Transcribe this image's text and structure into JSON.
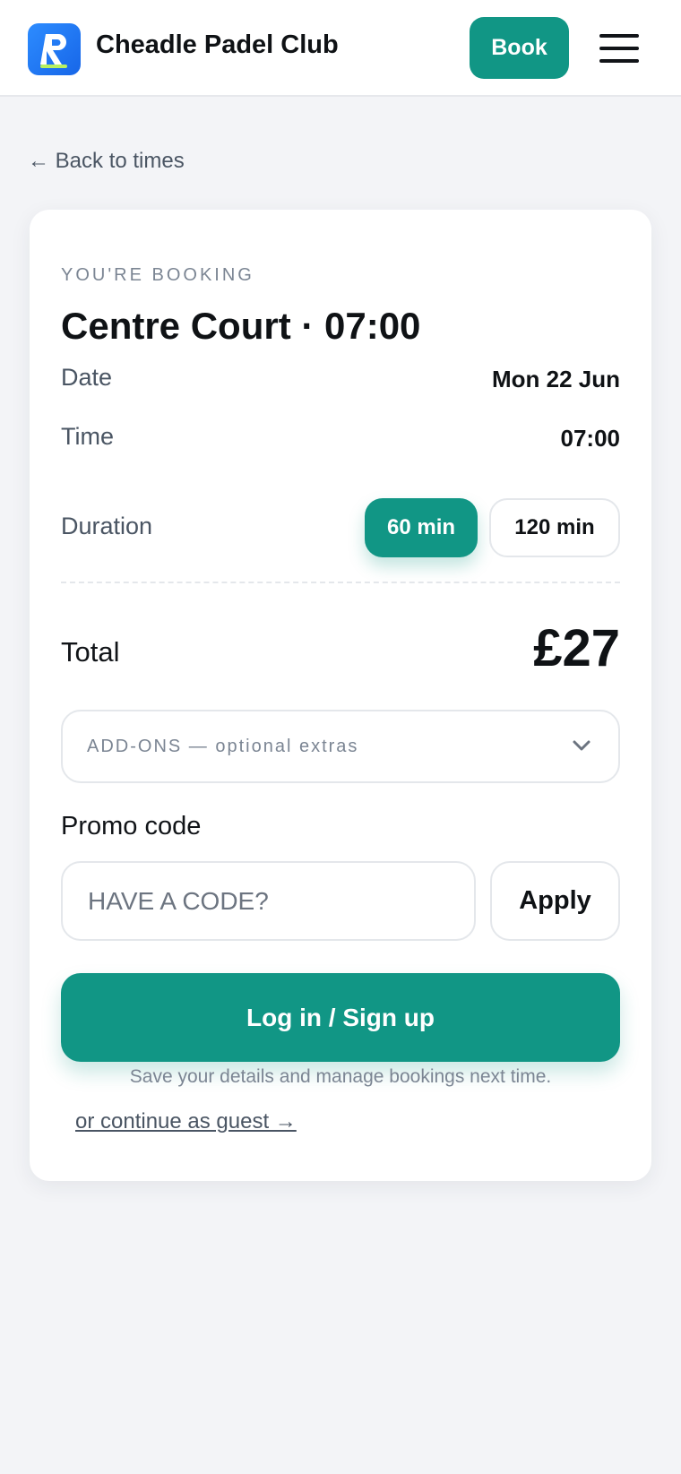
{
  "header": {
    "club_name": "Cheadle Padel Club",
    "book_label": "Book",
    "brand_color": "#119685",
    "logo_color": "#1f7cf2",
    "logo_letter": "R"
  },
  "back_link": "← Back to times",
  "booking": {
    "eyebrow": "YOU'RE BOOKING",
    "title": "Centre Court · 07:00",
    "rows": {
      "date": {
        "label": "Date",
        "value": "Mon 22 Jun"
      },
      "time": {
        "label": "Time",
        "value": "07:00"
      },
      "duration": {
        "label": "Duration",
        "options": [
          "60 min",
          "120 min"
        ],
        "selected": "60 min"
      }
    },
    "total": {
      "label": "Total",
      "value": "£27"
    },
    "addons_label": "ADD-ONS — optional extras",
    "promo": {
      "label": "Promo code",
      "placeholder": "HAVE A CODE?",
      "value": "",
      "apply_label": "Apply"
    },
    "login_label": "Log in / Sign up",
    "helper_text": "Save your details and manage bookings next time.",
    "guest_link": "or continue as guest →"
  },
  "icons": {
    "menu": "hamburger-menu-icon",
    "addons_toggle": "chevron-down-icon"
  }
}
